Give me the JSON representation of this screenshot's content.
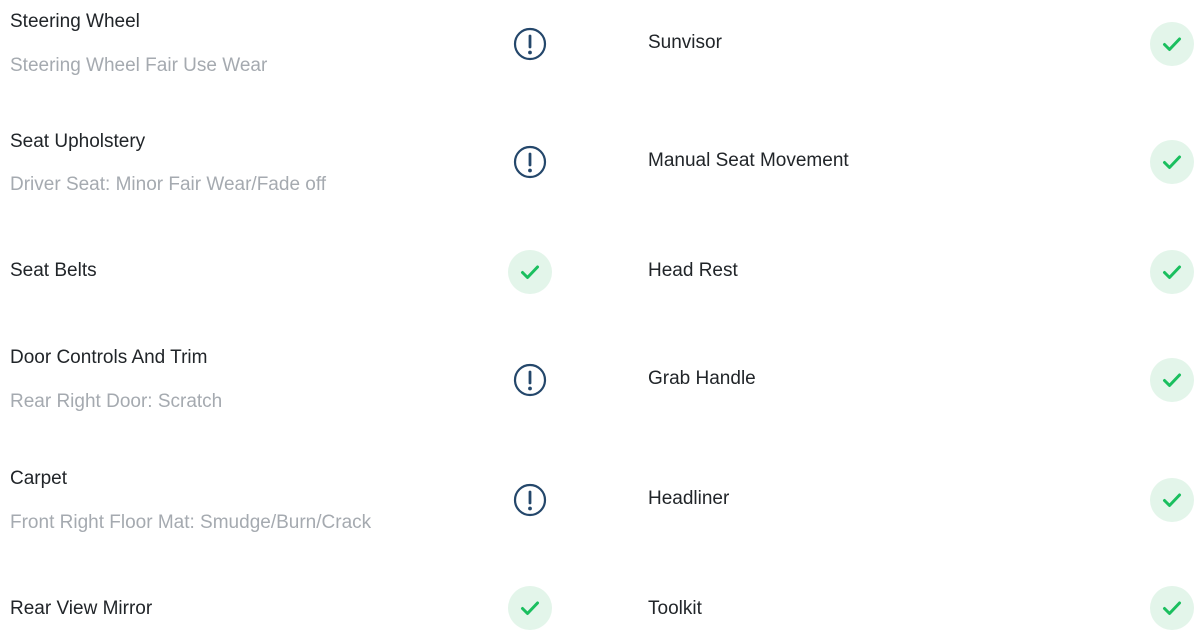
{
  "colors": {
    "ok": "#1bbf5f",
    "ok_bg": "#e3f5ea",
    "warn": "#24476b",
    "title": "#212529",
    "note": "#a5aab0"
  },
  "left_items": [
    {
      "name": "Steering Wheel",
      "note": "Steering Wheel Fair Use Wear",
      "status": "attention",
      "icon": "exclamation-icon"
    },
    {
      "name": "Seat Upholstery",
      "note": "Driver Seat: Minor Fair Wear/Fade off",
      "status": "attention",
      "icon": "exclamation-icon"
    },
    {
      "name": "Seat Belts",
      "note": "",
      "status": "ok",
      "icon": "check-icon"
    },
    {
      "name": "Door Controls And Trim",
      "note": "Rear Right Door: Scratch",
      "status": "attention",
      "icon": "exclamation-icon"
    },
    {
      "name": "Carpet",
      "note": "Front Right Floor Mat: Smudge/Burn/Crack",
      "status": "attention",
      "icon": "exclamation-icon"
    },
    {
      "name": "Rear View Mirror",
      "note": "",
      "status": "ok",
      "icon": "check-icon"
    }
  ],
  "right_items": [
    {
      "name": "Sunvisor",
      "status": "ok",
      "icon": "check-icon"
    },
    {
      "name": "Manual Seat Movement",
      "status": "ok",
      "icon": "check-icon"
    },
    {
      "name": "Head Rest",
      "status": "ok",
      "icon": "check-icon"
    },
    {
      "name": "Grab Handle",
      "status": "ok",
      "icon": "check-icon"
    },
    {
      "name": "Headliner",
      "status": "ok",
      "icon": "check-icon"
    },
    {
      "name": "Toolkit",
      "status": "ok",
      "icon": "check-icon"
    }
  ]
}
